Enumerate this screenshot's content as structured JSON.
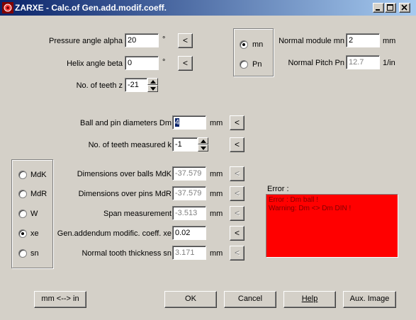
{
  "window": {
    "title": "ZARXE - Calc.of Gen.add.modif.coeff.",
    "icon": "gear-zarxe-icon"
  },
  "top": {
    "pressure_angle": {
      "label": "Pressure angle alpha",
      "value": "20",
      "unit": "°",
      "button": "<"
    },
    "helix_angle": {
      "label": "Helix angle beta",
      "value": "0",
      "unit": "°",
      "button": "<"
    },
    "teeth": {
      "label": "No. of teeth z",
      "value": "-21"
    }
  },
  "module_group": {
    "options": [
      {
        "label": "mn",
        "selected": true
      },
      {
        "label": "Pn",
        "selected": false
      }
    ]
  },
  "normal_module": {
    "label": "Normal module mn",
    "value": "2",
    "unit": "mm"
  },
  "normal_pitch": {
    "label": "Normal Pitch Pn",
    "value": "12.7",
    "unit": "1/in"
  },
  "ball_pin": {
    "label": "Ball and pin diameters  Dm",
    "value": "4",
    "unit": "mm",
    "button": "<"
  },
  "teeth_measured": {
    "label": "No. of teeth measured k",
    "value": "-1",
    "button": "<"
  },
  "mode_group": {
    "options": [
      {
        "label": "MdK",
        "selected": false
      },
      {
        "label": "MdR",
        "selected": false
      },
      {
        "label": "W",
        "selected": false
      },
      {
        "label": "xe",
        "selected": true
      },
      {
        "label": "sn",
        "selected": false
      }
    ]
  },
  "results": [
    {
      "label": "Dimensions over balls MdK",
      "value": "-37.579",
      "unit": "mm",
      "button": "<",
      "editable": false
    },
    {
      "label": "Dimensions over pins MdR",
      "value": "-37.579",
      "unit": "mm",
      "button": "<",
      "editable": false
    },
    {
      "label": "Span measurement",
      "value": "-3.513",
      "unit": "mm",
      "button": "<",
      "editable": false
    },
    {
      "label": "Gen.addendum modific. coeff. xe",
      "value": "0.02",
      "unit": "",
      "button": "<",
      "editable": true
    },
    {
      "label": "Normal tooth thickness sn",
      "value": "3.171",
      "unit": "mm",
      "button": "<",
      "editable": false
    }
  ],
  "error": {
    "label": "Error  :",
    "lines": [
      "Error  : Dm ball !",
      "Warning: Dm <> Dm DIN !"
    ],
    "color": "#ff0000"
  },
  "buttons": {
    "units": "mm <--> in",
    "ok": "OK",
    "cancel": "Cancel",
    "help": "Help",
    "aux": "Aux. Image"
  },
  "colors": {
    "face": "#d4d0c8",
    "titlebar": "#0a246a",
    "error_bg": "#ff0000"
  }
}
